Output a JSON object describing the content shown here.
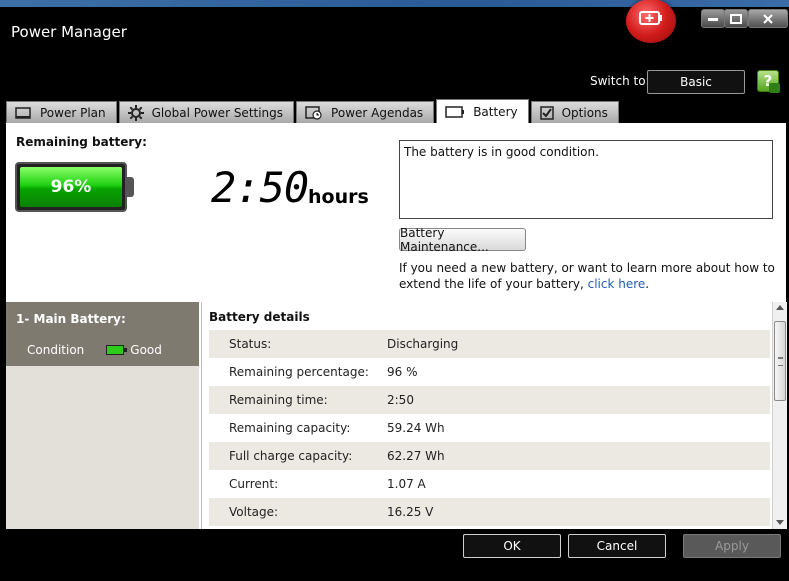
{
  "window": {
    "title": "Power Manager",
    "controls": {
      "minimize": "–",
      "maximize": "□",
      "close": "✕"
    }
  },
  "header": {
    "switch_label": "Switch to:",
    "switch_button": "Basic",
    "help_button": "?"
  },
  "tabs": [
    {
      "label": "Power Plan",
      "icon": "monitor-icon"
    },
    {
      "label": "Global Power Settings",
      "icon": "gear-icon"
    },
    {
      "label": "Power Agendas",
      "icon": "clock-icon"
    },
    {
      "label": "Battery",
      "icon": "battery-icon",
      "active": true
    },
    {
      "label": "Options",
      "icon": "checkbox-icon"
    }
  ],
  "battery_summary": {
    "label": "Remaining battery:",
    "percent": "96%",
    "percent_value": 96,
    "time_value": "2:50",
    "time_unit": "hours",
    "message": "The battery is in good condition.",
    "maintenance_button": "Battery Maintenance...",
    "help_text": "If you need a new battery, or want to learn more about how to extend the life of your battery,",
    "help_link": "click here",
    "help_end": "."
  },
  "battery_list": {
    "title": "1- Main Battery:",
    "condition_label": "Condition",
    "condition_value": "Good"
  },
  "details": {
    "title": "Battery details",
    "rows": [
      {
        "key": "Status:",
        "value": "Discharging"
      },
      {
        "key": "Remaining percentage:",
        "value": "96 %"
      },
      {
        "key": "Remaining time:",
        "value": "2:50"
      },
      {
        "key": "Remaining capacity:",
        "value": "59.24 Wh"
      },
      {
        "key": "Full charge capacity:",
        "value": "62.27 Wh"
      },
      {
        "key": "Current:",
        "value": "1.07 A"
      },
      {
        "key": "Voltage:",
        "value": "16.25 V"
      }
    ]
  },
  "footer": {
    "ok": "OK",
    "cancel": "Cancel",
    "apply": "Apply"
  },
  "colors": {
    "battery_green": "#1fd112",
    "badge_red": "#d21c1c",
    "link_blue": "#1f5db5"
  }
}
